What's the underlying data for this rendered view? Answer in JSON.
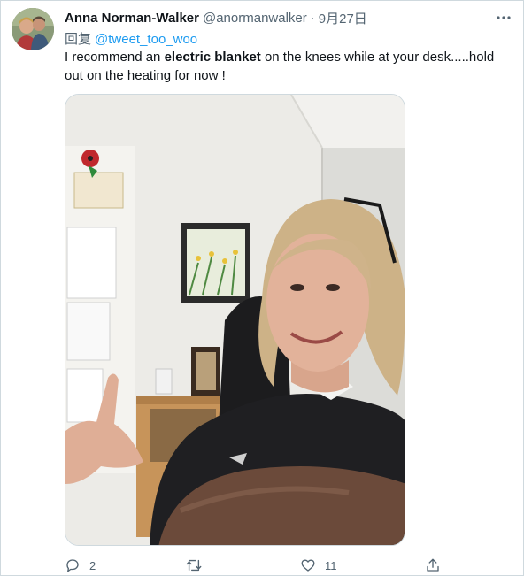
{
  "tweet": {
    "author_name": "Anna Norman-Walker",
    "handle": "@anormanwalker",
    "separator": "·",
    "date": "9月27日",
    "reply_prefix": "回复",
    "reply_to": "@tweet_too_woo",
    "text_part1": "I recommend an ",
    "text_bold": "electric blanket",
    "text_part2": " on the knees while at your desk.....hold out on the heating for now !"
  },
  "actions": {
    "replies": "2",
    "retweets": "",
    "likes": "11"
  },
  "icons": {
    "more": "more-horizontal-icon",
    "reply": "reply-bubble-icon",
    "retweet": "retweet-icon",
    "like": "heart-icon",
    "share": "share-icon"
  },
  "colors": {
    "link": "#1d9bf0",
    "secondary_text": "#536471",
    "primary_text": "#0f1419",
    "border": "#cfd9de"
  }
}
